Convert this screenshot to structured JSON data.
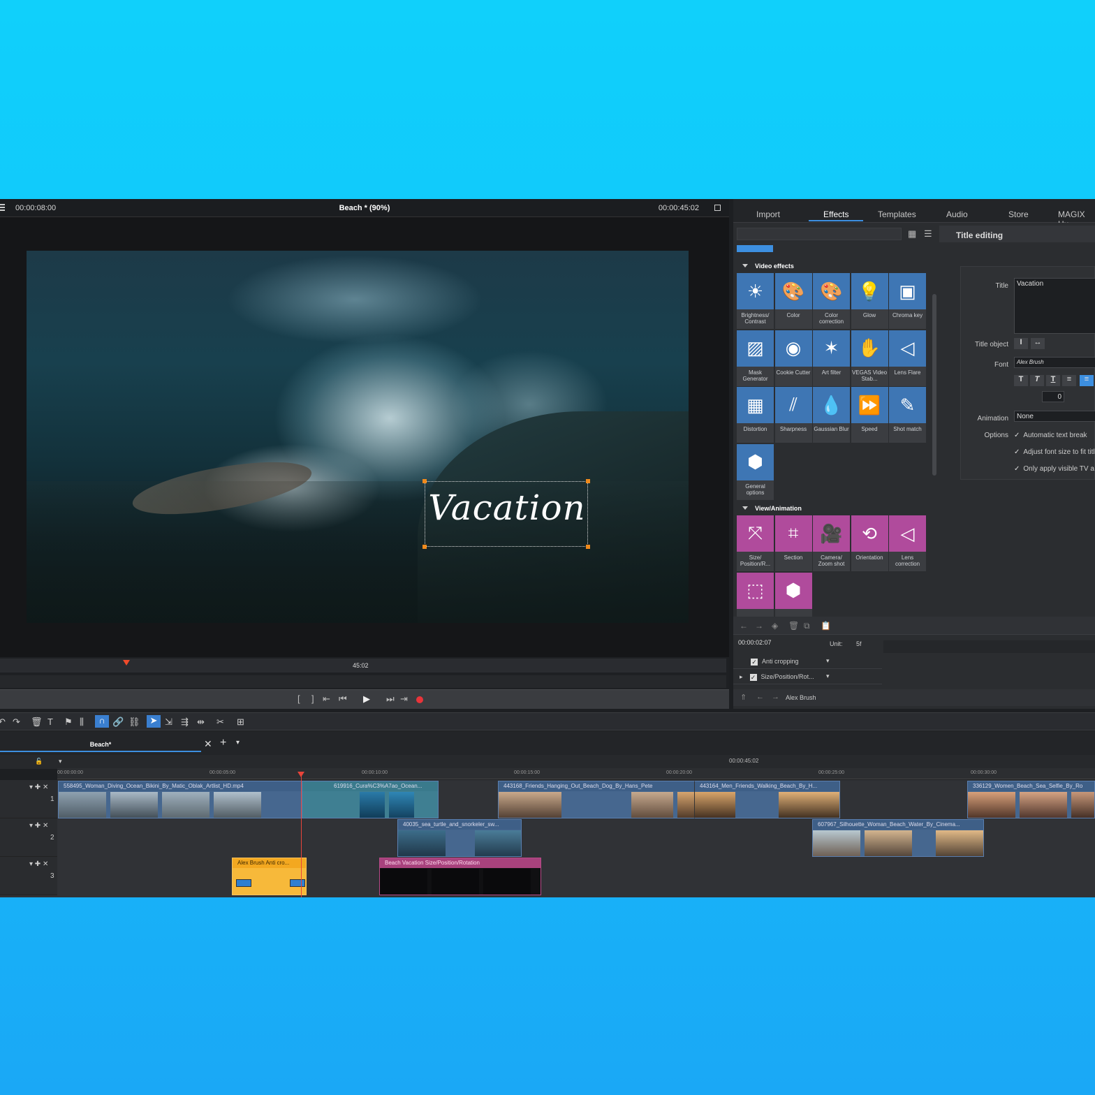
{
  "preview": {
    "timecode": "00:00:08:00",
    "title": "Beach *  (90%)",
    "duration": "00:00:45:02",
    "overlay_text": "Vacation",
    "scrub_label": "45:02"
  },
  "tabs": [
    {
      "label": "Import"
    },
    {
      "label": "Effects"
    },
    {
      "label": "Templates"
    },
    {
      "label": "Audio"
    },
    {
      "label": "Store"
    },
    {
      "label": "MAGIX Hu"
    }
  ],
  "library": {
    "video_effects_label": "Video effects",
    "video_effects": [
      {
        "name": "Brightness/\nContrast",
        "icon": "☀"
      },
      {
        "name": "Color",
        "icon": "🎨"
      },
      {
        "name": "Color correction",
        "icon": "🎨"
      },
      {
        "name": "Glow",
        "icon": "💡"
      },
      {
        "name": "Chroma key",
        "icon": "▣"
      },
      {
        "name": "Mask Generator",
        "icon": "▨"
      },
      {
        "name": "Cookie Cutter",
        "icon": "◉"
      },
      {
        "name": "Art filter",
        "icon": "✶"
      },
      {
        "name": "VEGAS Video Stab...",
        "icon": "✋"
      },
      {
        "name": "Lens Flare",
        "icon": "◁"
      },
      {
        "name": "Distortion",
        "icon": "▦"
      },
      {
        "name": "Sharpness",
        "icon": "⫽"
      },
      {
        "name": "Gaussian Blur",
        "icon": "💧"
      },
      {
        "name": "Speed",
        "icon": "⏩"
      },
      {
        "name": "Shot match",
        "icon": "✎"
      },
      {
        "name": "General options",
        "icon": "⬢"
      }
    ],
    "view_animation_label": "View/Animation",
    "view_animation": [
      {
        "name": "Size/ Position/R...",
        "icon": "⤧"
      },
      {
        "name": "Section",
        "icon": "⌗"
      },
      {
        "name": "Camera/ Zoom shot",
        "icon": "🎥"
      },
      {
        "name": "Orientation",
        "icon": "⟲"
      },
      {
        "name": "Lens correction",
        "icon": "◁"
      },
      {
        "name": "",
        "icon": "⬚"
      },
      {
        "name": "",
        "icon": "⬢"
      }
    ]
  },
  "title_editing": {
    "header": "Title editing",
    "title_label": "Title",
    "title_value": "Vacation",
    "title_object_label": "Title object",
    "font_label": "Font",
    "font_value": "Alex Brush",
    "spacing_value": "0",
    "animation_label": "Animation",
    "animation_value": "None",
    "options_label": "Options",
    "options": [
      "Automatic text break",
      "Adjust font size to fit title",
      "Only apply visible TV a"
    ]
  },
  "keyframes": {
    "timecode": "00:00:02:07",
    "unit_label": "Unit:",
    "unit_value": "5f",
    "rows": [
      "Anti cropping",
      "Size/Position/Rot..."
    ],
    "footer_font": "Alex Brush"
  },
  "timeline": {
    "tab": "Beach*",
    "end_time": "00:00:45:02",
    "ruler": [
      "00:00:00:00",
      "00:00:05:00",
      "00:00:10:00",
      "00:00:15:00",
      "00:00:20:00",
      "00:00:25:00",
      "00:00:30:00"
    ],
    "track_numbers": [
      "1",
      "2",
      "3"
    ],
    "clips": [
      {
        "name": "558495_Woman_Diving_Ocean_Bikini_By_Matic_Oblak_Artlist_HD.mp4"
      },
      {
        "name": "619916_Cura%C3%A7ao_Ocean..."
      },
      {
        "name": "443168_Friends_Hanging_Out_Beach_Dog_By_Hans_Pete"
      },
      {
        "name": "443164_Men_Friends_Walking_Beach_By_H..."
      },
      {
        "name": "336129_Women_Beach_Sea_Selfie_By_Ro"
      },
      {
        "name": "40035_sea_turtle_and_snorkeler_sw..."
      },
      {
        "name": "607967_Silhouette_Woman_Beach_Water_By_Cinema..."
      },
      {
        "name": "Alex Brush   Anti cro..."
      },
      {
        "name": "Beach Vacation   Size/Position/Rotation"
      }
    ]
  },
  "colors": {
    "accent": "#3d8fe0",
    "effect_blue": "#3e76b4",
    "effect_magenta": "#b04b9c",
    "playhead": "#e8443a",
    "title_clip": "#f7b93a"
  }
}
